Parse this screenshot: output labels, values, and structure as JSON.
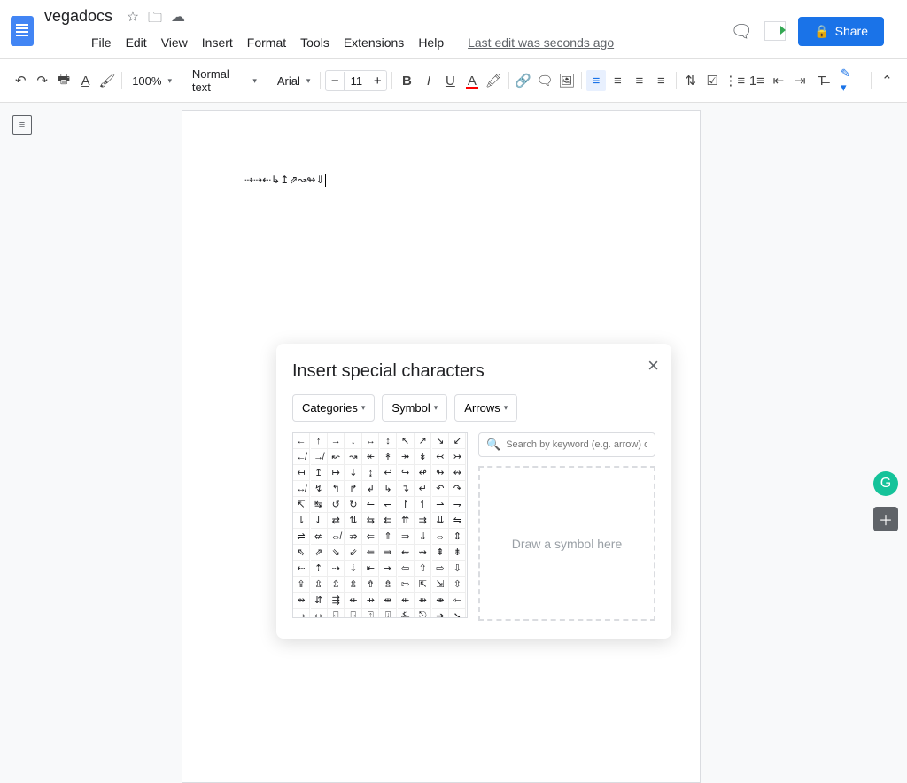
{
  "header": {
    "title": "vegadocs",
    "menus": [
      "File",
      "Edit",
      "View",
      "Insert",
      "Format",
      "Tools",
      "Extensions",
      "Help"
    ],
    "last_edit": "Last edit was seconds ago",
    "share_label": "Share"
  },
  "toolbar": {
    "zoom": "100%",
    "style": "Normal text",
    "font": "Arial",
    "font_size": "11"
  },
  "document": {
    "content": "⇢⇢⇠↳↥⇗↝↬⇓"
  },
  "modal": {
    "title": "Insert special characters",
    "filters": [
      "Categories",
      "Symbol",
      "Arrows"
    ],
    "search_placeholder": "Search by keyword (e.g. arrow) or code point",
    "draw_hint": "Draw a symbol here",
    "chars": [
      "←",
      "↑",
      "→",
      "↓",
      "↔",
      "↕",
      "↖",
      "↗",
      "↘",
      "↙",
      "↚",
      "↛",
      "↜",
      "↝",
      "↞",
      "↟",
      "↠",
      "↡",
      "↢",
      "↣",
      "↤",
      "↥",
      "↦",
      "↧",
      "↨",
      "↩",
      "↪",
      "↫",
      "↬",
      "↭",
      "↮",
      "↯",
      "↰",
      "↱",
      "↲",
      "↳",
      "↴",
      "↵",
      "↶",
      "↷",
      "↸",
      "↹",
      "↺",
      "↻",
      "↼",
      "↽",
      "↾",
      "↿",
      "⇀",
      "⇁",
      "⇂",
      "⇃",
      "⇄",
      "⇅",
      "⇆",
      "⇇",
      "⇈",
      "⇉",
      "⇊",
      "⇋",
      "⇌",
      "⇍",
      "⇎",
      "⇏",
      "⇐",
      "⇑",
      "⇒",
      "⇓",
      "⇔",
      "⇕",
      "⇖",
      "⇗",
      "⇘",
      "⇙",
      "⇚",
      "⇛",
      "⇜",
      "⇝",
      "⇞",
      "⇟",
      "⇠",
      "⇡",
      "⇢",
      "⇣",
      "⇤",
      "⇥",
      "⇦",
      "⇧",
      "⇨",
      "⇩",
      "⇪",
      "⇫",
      "⇬",
      "⇭",
      "⇮",
      "⇯",
      "⇰",
      "⇱",
      "⇲",
      "⇳",
      "⇴",
      "⇵",
      "⇶",
      "⇷",
      "⇸",
      "⇹",
      "⇺",
      "⇻",
      "⇼",
      "⇽",
      "⇾",
      "⇿",
      "⍇",
      "⍈",
      "⍐",
      "⍗",
      "⍼",
      "⎋",
      "➔",
      "➘"
    ]
  }
}
